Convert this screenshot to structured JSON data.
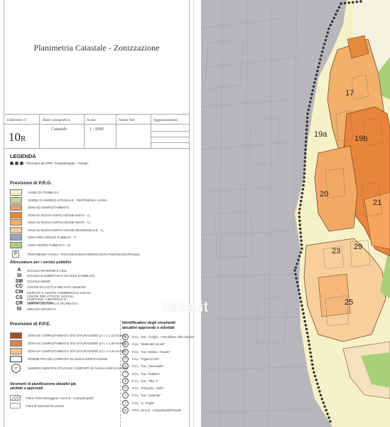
{
  "title": "Planimetria Catastale - Zonizzazione",
  "header": {
    "elaborato_label": "Elaborato n°:",
    "base_label": "Base cartografica:",
    "scale_label": "Scala:",
    "file_label": "Nome file:",
    "update_label": "Aggiornamenti:",
    "code_main": "10",
    "code_suffix": "R",
    "base_value": "Catastale",
    "scale_value": "1 : 2000"
  },
  "legend": {
    "title": "LEGENDA",
    "perimeter_text": "Perimetro del PPE \"Campolimpido - Favale\"",
    "prg_title": "Previsioni di P.R.G.",
    "prg_items": [
      {
        "label": "VIABILITA' PUBBLICA",
        "color": "#f6efc4"
      },
      {
        "label": "VERDE DI ARREDO STRADALE - PERTINENZA VIARIA",
        "color": "#c9d59a"
      },
      {
        "label": "ZONA B) COMPLETAMENTO",
        "color": "#e0a070"
      },
      {
        "label": "ZONA DI NUOVA EDIFICAZIONE MISTA - C₁",
        "color": "#e58a3c"
      },
      {
        "label": "ZONA DI NUOVA EDIFICAZIONE MISTA - C₂",
        "color": "#f2b06a"
      },
      {
        "label": "ZONA DI NUOVA EDIFICAZIONE RESIDENZIALE - C₃",
        "color": "#f8cf9a"
      },
      {
        "label": "ZONA PER SERVIZI PUBBLICI - F",
        "color": "#9aa4c8"
      },
      {
        "label": "ZONA VERDE PUBBLICO - G₁",
        "color": "#a9cf7a"
      }
    ],
    "parking_letter": "P",
    "parking_text": "PERTINENZA VIARIA - PARCHEGGIO/GIARDINO ED/O PARCHEGGIO/PIAZZA",
    "services_title": "Attrezzature per i servizi pubblici",
    "services": [
      {
        "code": "A",
        "label": "SCUOLE MATERNE E ASILI"
      },
      {
        "code": "SI",
        "label": "SCUOLE ELEMENTARI E SCUOLE D'OBBLIGO"
      },
      {
        "code": "SM",
        "label": "SCUOLE MEDIE"
      },
      {
        "code": "CC",
        "label": "CENTRI DI CULTO E RELATIVI ANNESSI"
      },
      {
        "code": "CM",
        "label": "MERCATI E CENTRI COMMERCIALI LOCALI"
      },
      {
        "code": "CS",
        "label": "CENTRI PER ATTIVITA' SOCIALI, SANITARIE, CIMITERIALI E AMMINISTRATIVE"
      },
      {
        "code": "CR",
        "label": "CENTRI CULTURALI E RICREATIVI"
      },
      {
        "code": "IS",
        "label": "IMPIANTI SPORTIVI"
      }
    ],
    "ppe_title": "Previsioni di P.P.E.",
    "ppe_items": [
      {
        "label": "ZONA DI COMPLETAMENTO E/O SATURAZIONE (I.f.t. ≤ 2,10 mc/mq)",
        "color": "#a0502a"
      },
      {
        "label": "ZONA DI COMPLETAMENTO E/O SATURAZIONE (I.f.t. ≤ 1,58 mc/mq)",
        "color": "#d4874e"
      },
      {
        "label": "ZONA DI COMPLETAMENTO E/O SATURAZIONE (I.f.t. ≤ 0,45 mc/mq)",
        "color": "#ecc58f"
      },
      {
        "label": "PERIMETRO DEI COMPARTI DI NUOVA EDIFICAZIONE",
        "color": "#ffffff"
      }
    ],
    "comparto_symbol": "n°",
    "comparto_text": "NUMERO IDENTIFICATIVO DEI COMPARTI DI NUOVA EDIFICAZIONE",
    "strumenti_title": "Strumenti di pianificazione attuativi già adottati o approvati",
    "strumenti": [
      "Piano Particolareggiato \"Zona B - Campolimpido\"",
      "Piani di lottizzazione privati"
    ],
    "pel_title": "Identificativo degli strumenti attuativi approvati o adottati",
    "pel_items": [
      {
        "letter": "a",
        "label": "P.d.L. \"Soc. Il Giglio - Immobiliare Villa Adriana\""
      },
      {
        "letter": "b",
        "label": "P.d.L. \"Mastroddi ed altri\""
      },
      {
        "letter": "c",
        "label": "P.d.L. \"Soc. Stefani - Favale\""
      },
      {
        "letter": "d",
        "label": "P.d.L. \"Figlia ed Altri\""
      },
      {
        "letter": "e",
        "label": "P.d.L. \"Soc. Carciavallo\""
      },
      {
        "letter": "f",
        "label": "P.d.L. \"Soc. Palatina\""
      },
      {
        "letter": "g",
        "label": "P.d.L. \"Soc. Tibur 2\""
      },
      {
        "letter": "h",
        "label": "P.d.L. \"Pellegrini - Rullo\""
      },
      {
        "letter": "i",
        "label": "P.d.L. \"Soc. Calamite\""
      },
      {
        "letter": "l",
        "label": "P.d.L. \"Li. Paglia\""
      },
      {
        "letter": "m",
        "label": "P.P.E. zona B - Campolimpido/Favale"
      }
    ]
  },
  "map": {
    "labels": [
      "17",
      "19a",
      "19b",
      "20",
      "21",
      "23",
      "29",
      "25"
    ]
  },
  "watermark": "casa.it"
}
